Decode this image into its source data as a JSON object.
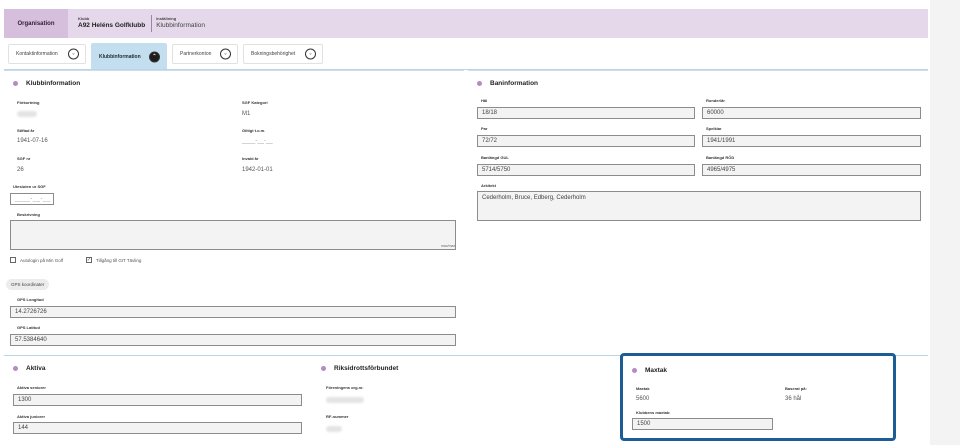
{
  "header": {
    "org_label": "Organisation",
    "club_small": "Klubb",
    "club_name": "A92 Heléns Golfklubb",
    "settings_small": "Inställning",
    "settings_name": "Klubbinformation"
  },
  "tabs": [
    {
      "label": "Kontaktinformation",
      "icon": "chevron-down-icon"
    },
    {
      "label": "Klubbinformation",
      "icon": "chevron-up-icon"
    },
    {
      "label": "Partnerkonton",
      "icon": "chevron-down-icon"
    },
    {
      "label": "Bokningsbehörighet",
      "icon": "chevron-down-icon"
    }
  ],
  "klubbinfo": {
    "title": "Klubbinformation",
    "forkortning_label": "Förkortning",
    "sgf_kategori_label": "SGF Kategori",
    "sgf_kategori_value": "M1",
    "stiftad_label": "Stiftad år",
    "stiftad_value": "1941-07-16",
    "giltigt_label": "Giltigt t.o.m.",
    "giltigt_value": "____-__-__",
    "sgf_nr_label": "SGF nr",
    "sgf_nr_value": "26",
    "invald_label": "Invald år",
    "invald_value": "1942-01-01",
    "utesluten_label": "Utesluten ur SGF",
    "utesluten_value": "____-__-__",
    "beskrivning_label": "Beskrivning",
    "beskrivning_counter": "max/max",
    "autologin_label": "Autologin på Min Golf",
    "tillgang_label": "Tillgång till GIT Tävling",
    "gps_pill": "GPS koordinater",
    "gps_long_label": "GPS Longitud",
    "gps_long_value": "14.2726726",
    "gps_lat_label": "GPS Latitud",
    "gps_lat_value": "57.5384640"
  },
  "baninfo": {
    "title": "Baninformation",
    "hal_label": "Hål",
    "hal_value": "18/18",
    "ronder_label": "Ronder/år",
    "ronder_value": "60000",
    "par_label": "Par",
    "par_value": "72/72",
    "spelklar_label": "Spelklar",
    "spelklar_value": "1941/1991",
    "gul_label": "Banlängd GUL",
    "gul_value": "5714/5750",
    "rod_label": "Banlängd RÖD",
    "rod_value": "4965/4975",
    "arkitekt_label": "Arkitekt",
    "arkitekt_value": "Cederholm, Bruce, Edberg, Cederholm"
  },
  "aktiva": {
    "title": "Aktiva",
    "seniorer_label": "Aktiva seniorer",
    "seniorer_value": "1300",
    "juniorer_label": "Aktiva juniorer",
    "juniorer_value": "144"
  },
  "riksidrott": {
    "title": "Riksidrottsförbundet",
    "orgnr_label": "Föreningens org.nr.",
    "rf_label": "RF-nummer"
  },
  "maxtak": {
    "title": "Maxtak",
    "maxtak_label": "Maxtak",
    "maxtak_value": "5600",
    "baserat_label": "Baserat på:",
    "baserat_value": "36 hål",
    "klubbens_label": "Klubbens maxtak:",
    "klubbens_value": "1500"
  },
  "colors": {
    "header_bg": "#e5d8ea",
    "org_bg": "#d6bfdc",
    "active_tab": "#c3dfef",
    "dot": "#b58bc3",
    "highlight": "#1d5d95"
  }
}
